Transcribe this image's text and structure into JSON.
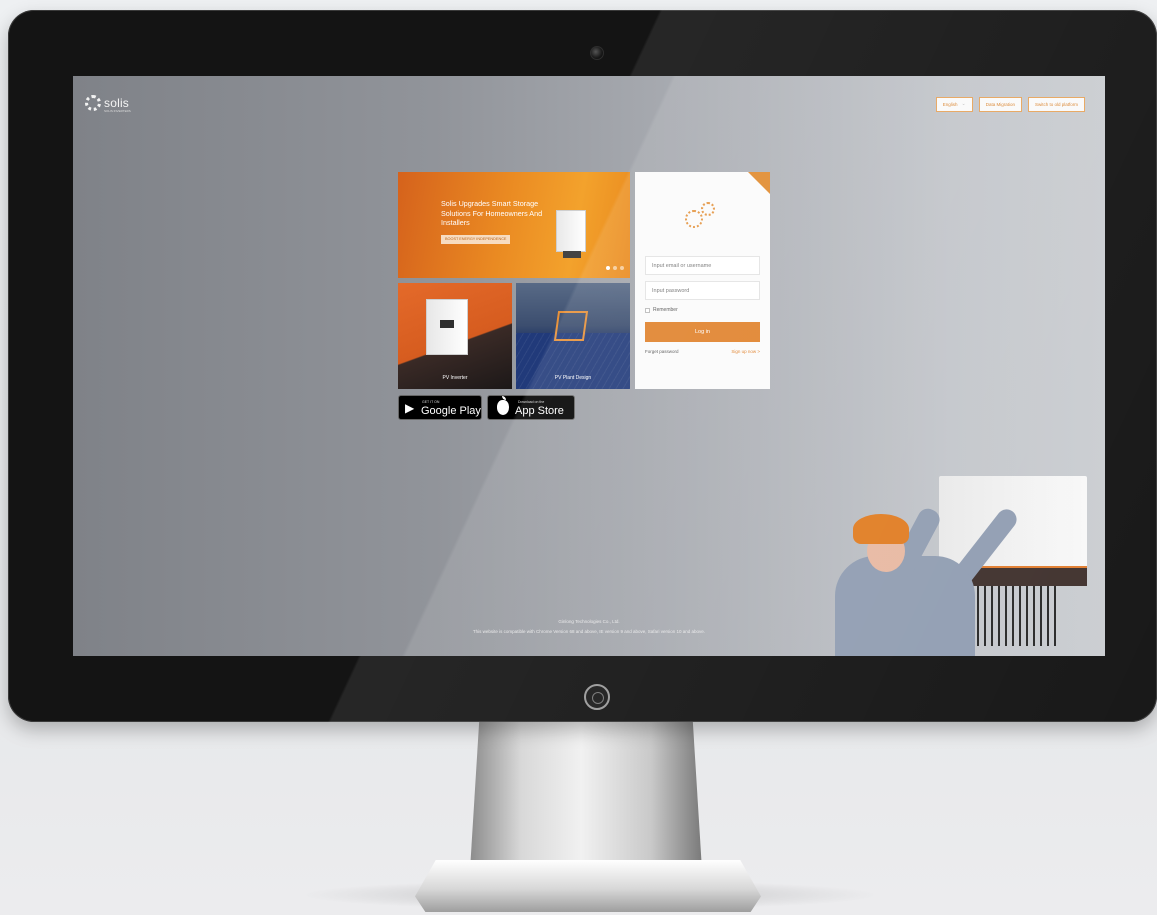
{
  "brand": {
    "logo_text": "solis",
    "logo_subtext": "SOLIS INVERTERS"
  },
  "top_buttons": {
    "language": "English",
    "data_migration": "Data Migration",
    "switch_platform": "Switch to old platform"
  },
  "banner": {
    "title": "Solis Upgrades Smart Storage Solutions For Homeowners And Installers",
    "tag": "BOOST ENERGY INDEPENDENCE",
    "slides": 3,
    "active_slide": 1
  },
  "tiles": [
    {
      "label": "PV Inverter"
    },
    {
      "label": "PV Plant Design"
    }
  ],
  "badges": {
    "google_small": "GET IT ON",
    "google_big": "Google Play",
    "apple_small": "Download on the",
    "apple_big": "App Store"
  },
  "login": {
    "email_placeholder": "Input email or username",
    "password_placeholder": "Input password",
    "remember_label": "Remember",
    "login_button": "Log in",
    "forgot_link": "Forget password",
    "signup_link": "Sign up now  >"
  },
  "footer": {
    "company": "Ginlong Technologies Co., Ltd.",
    "compatibility": "This website is compatible with Chrome Version 68 and above, IE version 9 and above, Safari version 10 and above."
  },
  "colors": {
    "accent": "#e0822c",
    "bezel": "#141414"
  }
}
